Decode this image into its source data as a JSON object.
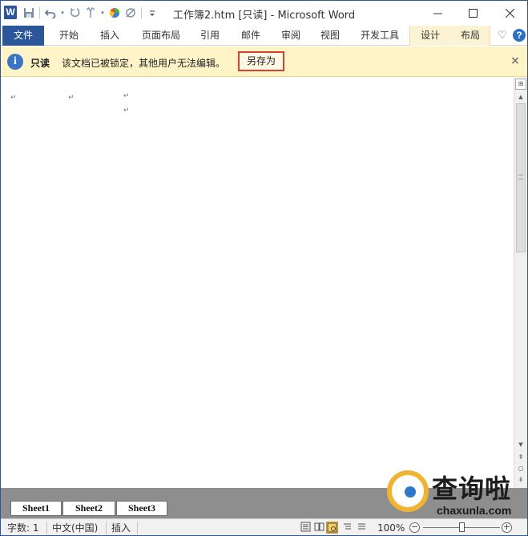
{
  "window": {
    "title": "工作簿2.htm [只读]  -  Microsoft Word",
    "logo_letter": "W",
    "minimize_glyph": "—",
    "maximize_glyph": "☐",
    "close_glyph": "✕"
  },
  "quick_access": {
    "icons": [
      "save-icon",
      "undo-icon",
      "redo-icon",
      "format-painter-icon",
      "color-icon",
      "clear-icon",
      "customize-icon"
    ]
  },
  "ribbon": {
    "file_label": "文件",
    "tabs": [
      "开始",
      "插入",
      "页面布局",
      "引用",
      "邮件",
      "审阅",
      "视图",
      "开发工具"
    ],
    "contextual_tabs": [
      "设计",
      "布局"
    ],
    "expand_glyph": "♡",
    "help_glyph": "?"
  },
  "message_bar": {
    "title": "只读",
    "text": "该文档已被锁定，其他用户无法编辑。",
    "button_label": "另存为",
    "close_glyph": "×",
    "info_glyph": "i"
  },
  "document": {
    "paragraph_mark": "↵"
  },
  "scrollbar": {
    "ruler_glyph": "⊞",
    "up_glyph": "▲",
    "down_glyph": "▼",
    "prev_page_glyph": "⇞",
    "select_browse_glyph": "○",
    "next_page_glyph": "⇟"
  },
  "sheet_tabs": [
    "Sheet1",
    "Sheet2",
    "Sheet3"
  ],
  "watermark": {
    "title": "查询啦",
    "url": "chaxunla.com"
  },
  "status_bar": {
    "word_count": "字数: 1",
    "language": "中文(中国)",
    "insert_mode": "插入",
    "zoom": "100%",
    "zoom_minus": "−",
    "zoom_plus": "+",
    "zoom_fraction": 0.5
  },
  "colors": {
    "accent": "#2b579a",
    "message_bar": "#fef4c8",
    "highlight_border": "#d9402c"
  }
}
